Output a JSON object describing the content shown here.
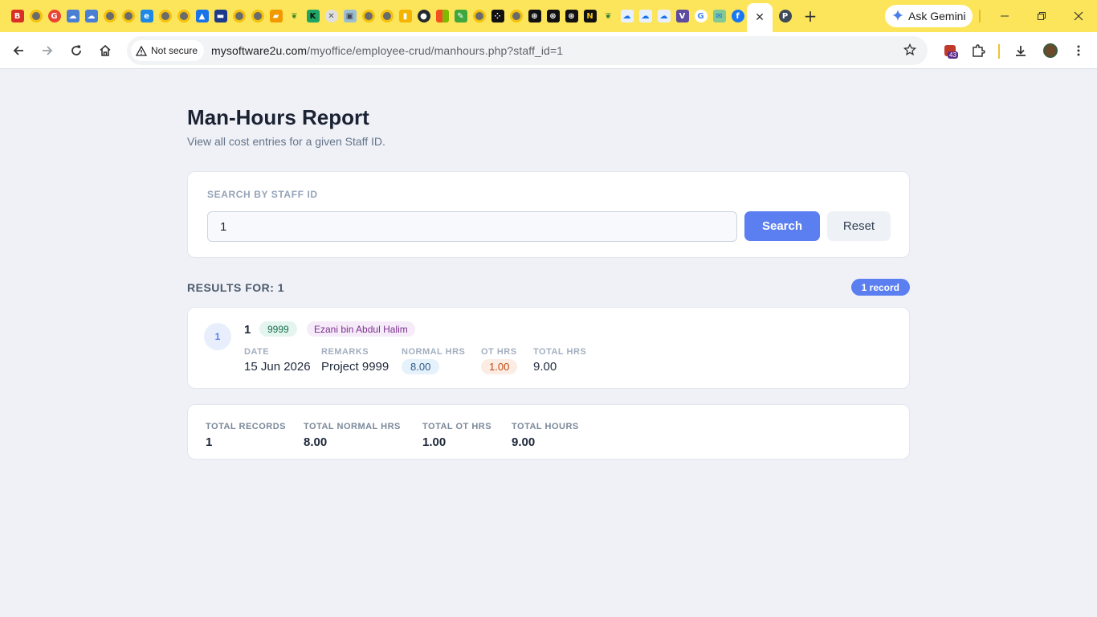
{
  "browser": {
    "tabs_favicons": [
      "b-icon",
      "chrome-icon",
      "g-red-icon",
      "cloud-icon",
      "cloud-icon",
      "chrome-icon",
      "chrome-icon",
      "ie-icon",
      "chrome-icon",
      "chrome-icon",
      "drive-icon",
      "ban-icon",
      "chrome-icon",
      "chrome-icon",
      "bookmark-icon",
      "leaf-icon",
      "dk-icon",
      "compass-icon",
      "box-icon",
      "chrome-icon",
      "chrome-icon",
      "chart-icon",
      "github-icon",
      "windows-icon",
      "green-icon",
      "chrome-icon",
      "dots-icon",
      "chrome-icon",
      "openai-icon",
      "openai-icon",
      "openai-icon",
      "n-icon",
      "leaf-icon",
      "cloud-icon",
      "cloud-icon",
      "cloud-icon",
      "v-icon",
      "google-icon",
      "mail-icon",
      "facebook-icon"
    ],
    "active_tab_close": "✕",
    "active_after_tab": "p-icon",
    "new_tab": "+",
    "ask_gemini": "Ask Gemini",
    "security_label": "Not secure",
    "url_host": "mysoftware2u.com",
    "url_path": "/myoffice/employee-crud/manhours.php?staff_id=1",
    "extension_badge": "43"
  },
  "page": {
    "title": "Man-Hours Report",
    "subtitle": "View all cost entries for a given Staff ID."
  },
  "search": {
    "label": "SEARCH BY STAFF ID",
    "value": "1",
    "search_label": "Search",
    "reset_label": "Reset"
  },
  "results": {
    "heading": "RESULTS FOR: 1",
    "count_label": "1 record"
  },
  "records": [
    {
      "index": "1",
      "staff_id": "1",
      "code": "9999",
      "name": "Ezani bin Abdul Halim",
      "date_label": "DATE",
      "date": "15 Jun 2026",
      "remarks_label": "REMARKS",
      "remarks": "Project 9999",
      "normal_label": "NORMAL HRS",
      "normal": "8.00",
      "ot_label": "OT HRS",
      "ot": "1.00",
      "total_label": "TOTAL HRS",
      "total": "9.00"
    }
  ],
  "summary": {
    "records_label": "TOTAL RECORDS",
    "records": "1",
    "normal_label": "TOTAL NORMAL HRS",
    "normal": "8.00",
    "ot_label": "TOTAL OT HRS",
    "ot": "1.00",
    "hours_label": "TOTAL HOURS",
    "hours": "9.00"
  },
  "colors": {
    "tab_bar": "#fde55b",
    "accent": "#5b7ff0",
    "page_bg": "#eff1f6"
  }
}
